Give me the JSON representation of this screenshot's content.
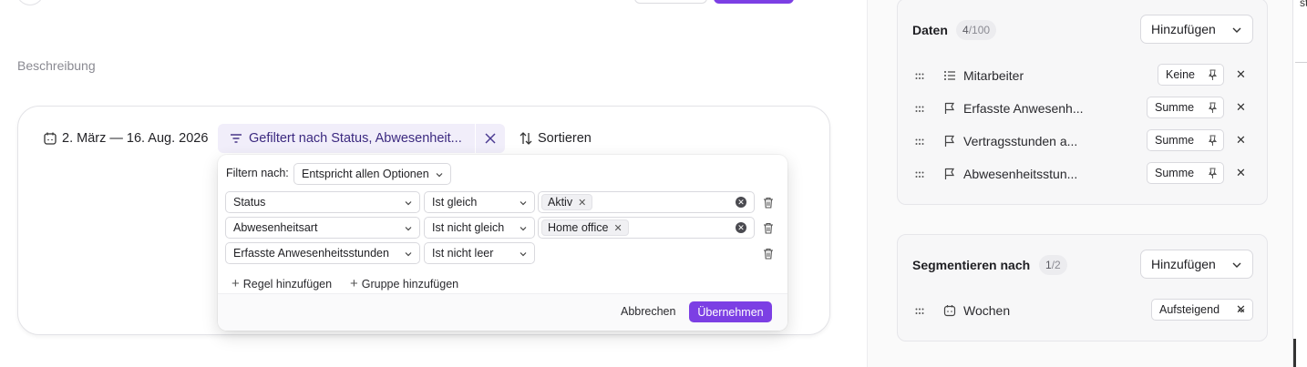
{
  "main": {
    "description_label": "Beschreibung"
  },
  "toolbar": {
    "date_range": "2. März — 16. Aug. 2026",
    "filter_summary": "Gefiltert nach Status, Abwesenheit...",
    "sort_label": "Sortieren"
  },
  "filter_popover": {
    "filter_by_label": "Filtern nach:",
    "match_mode": "Entspricht allen Optionen",
    "rules": [
      {
        "field": "Status",
        "operator": "Ist gleich",
        "value": "Aktiv"
      },
      {
        "field": "Abwesenheitsart",
        "operator": "Ist nicht gleich",
        "value": "Home office"
      },
      {
        "field": "Erfasste Anwesenheitsstunden",
        "operator": "Ist nicht leer",
        "value": ""
      }
    ],
    "add_rule_label": "Regel hinzufügen",
    "add_group_label": "Gruppe hinzufügen",
    "cancel_label": "Abbrechen",
    "apply_label": "Übernehmen"
  },
  "data_panel": {
    "title": "Daten",
    "count": "4",
    "count_total": "/100",
    "add_label": "Hinzufügen",
    "rows": [
      {
        "label": "Mitarbeiter",
        "icon": "list-icon",
        "aggregation": "Keine"
      },
      {
        "label": "Erfasste Anwesenh...",
        "icon": "flag-icon",
        "aggregation": "Summe"
      },
      {
        "label": "Vertragsstunden a...",
        "icon": "flag-icon",
        "aggregation": "Summe"
      },
      {
        "label": "Abwesenheitsstun...",
        "icon": "flag-icon",
        "aggregation": "Summe"
      }
    ]
  },
  "segment_panel": {
    "title": "Segmentieren nach",
    "count": "1",
    "count_total": "/2",
    "add_label": "Hinzufügen",
    "rows": [
      {
        "label": "Wochen",
        "icon": "calendar-icon",
        "order": "Aufsteigend"
      }
    ]
  },
  "edge": {
    "text": "st"
  },
  "colors": {
    "accent": "#7c3fe4",
    "filter_chip_bg": "#f1eefa"
  }
}
